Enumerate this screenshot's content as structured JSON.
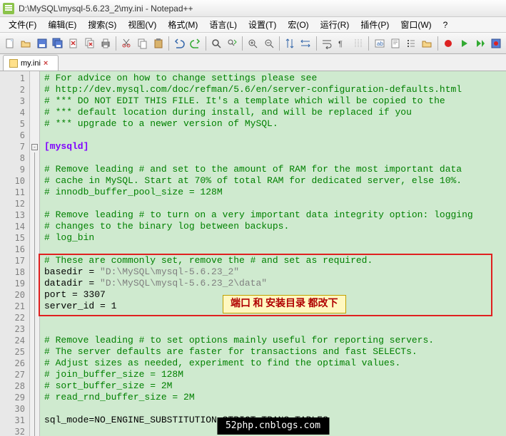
{
  "window": {
    "title": "D:\\MySQL\\mysql-5.6.23_2\\my.ini - Notepad++"
  },
  "menu": {
    "items": [
      {
        "label": "文件(F)"
      },
      {
        "label": "编辑(E)"
      },
      {
        "label": "搜索(S)"
      },
      {
        "label": "视图(V)"
      },
      {
        "label": "格式(M)"
      },
      {
        "label": "语言(L)"
      },
      {
        "label": "设置(T)"
      },
      {
        "label": "宏(O)"
      },
      {
        "label": "运行(R)"
      },
      {
        "label": "插件(P)"
      },
      {
        "label": "窗口(W)"
      },
      {
        "label": "?"
      }
    ]
  },
  "tab": {
    "name": "my.ini",
    "close": "×"
  },
  "code": {
    "lines": [
      {
        "n": 1,
        "t": "# For advice on how to change settings please see",
        "cls": "comment"
      },
      {
        "n": 2,
        "t": "# http://dev.mysql.com/doc/refman/5.6/en/server-configuration-defaults.html",
        "cls": "comment"
      },
      {
        "n": 3,
        "t": "# *** DO NOT EDIT THIS FILE. It's a template which will be copied to the",
        "cls": "comment"
      },
      {
        "n": 4,
        "t": "# *** default location during install, and will be replaced if you",
        "cls": "comment"
      },
      {
        "n": 5,
        "t": "# *** upgrade to a newer version of MySQL.",
        "cls": "comment"
      },
      {
        "n": 6,
        "t": "",
        "cls": ""
      },
      {
        "n": 7,
        "t": "[mysqld]",
        "cls": "section",
        "fold": true
      },
      {
        "n": 8,
        "t": "",
        "cls": ""
      },
      {
        "n": 9,
        "t": "# Remove leading # and set to the amount of RAM for the most important data",
        "cls": "comment"
      },
      {
        "n": 10,
        "t": "# cache in MySQL. Start at 70% of total RAM for dedicated server, else 10%.",
        "cls": "comment"
      },
      {
        "n": 11,
        "t": "# innodb_buffer_pool_size = 128M",
        "cls": "comment"
      },
      {
        "n": 12,
        "t": "",
        "cls": ""
      },
      {
        "n": 13,
        "t": "# Remove leading # to turn on a very important data integrity option: logging",
        "cls": "comment"
      },
      {
        "n": 14,
        "t": "# changes to the binary log between backups.",
        "cls": "comment"
      },
      {
        "n": 15,
        "t": "# log_bin",
        "cls": "comment"
      },
      {
        "n": 16,
        "t": "",
        "cls": ""
      },
      {
        "n": 17,
        "t": "# These are commonly set, remove the # and set as required.",
        "cls": "comment"
      },
      {
        "n": 18,
        "kv": {
          "k": "basedir",
          "v": "\"D:\\MySQL\\mysql-5.6.23_2\""
        }
      },
      {
        "n": 19,
        "kv": {
          "k": "datadir",
          "v": "\"D:\\MySQL\\mysql-5.6.23_2\\data\""
        }
      },
      {
        "n": 20,
        "kv": {
          "k": "port",
          "v": "3307"
        }
      },
      {
        "n": 21,
        "kv": {
          "k": "server_id",
          "v": "1"
        }
      },
      {
        "n": 22,
        "t": "",
        "cls": ""
      },
      {
        "n": 23,
        "t": "",
        "cls": ""
      },
      {
        "n": 24,
        "t": "# Remove leading # to set options mainly useful for reporting servers.",
        "cls": "comment"
      },
      {
        "n": 25,
        "t": "# The server defaults are faster for transactions and fast SELECTs.",
        "cls": "comment"
      },
      {
        "n": 26,
        "t": "# Adjust sizes as needed, experiment to find the optimal values.",
        "cls": "comment"
      },
      {
        "n": 27,
        "t": "# join_buffer_size = 128M",
        "cls": "comment"
      },
      {
        "n": 28,
        "t": "# sort_buffer_size = 2M",
        "cls": "comment"
      },
      {
        "n": 29,
        "t": "# read_rnd_buffer_size = 2M",
        "cls": "comment"
      },
      {
        "n": 30,
        "t": "",
        "cls": ""
      },
      {
        "n": 31,
        "kv": {
          "k": "sql_mode",
          "v": "NO_ENGINE_SUBSTITUTION,STRICT_TRANS_TABLES",
          "noquote": true
        }
      },
      {
        "n": 32,
        "t": "",
        "cls": ""
      }
    ]
  },
  "annotation": {
    "text": "端口 和 安装目录  都改下"
  },
  "watermark": {
    "text": "52php.cnblogs.com"
  },
  "toolbar_icons": [
    "new-file",
    "open-file",
    "save-file",
    "save-all",
    "close-file",
    "close-all",
    "print",
    "sep",
    "cut",
    "copy",
    "paste",
    "sep",
    "undo",
    "redo",
    "sep",
    "find",
    "replace",
    "sep",
    "zoom-in",
    "zoom-out",
    "sep",
    "sync-v",
    "sync-h",
    "sep",
    "wrap",
    "all-chars",
    "indent-guide",
    "sep",
    "lang",
    "doc-map",
    "func-list",
    "folder",
    "sep",
    "macro-rec",
    "macro-play",
    "macro-replay",
    "macro-save"
  ]
}
